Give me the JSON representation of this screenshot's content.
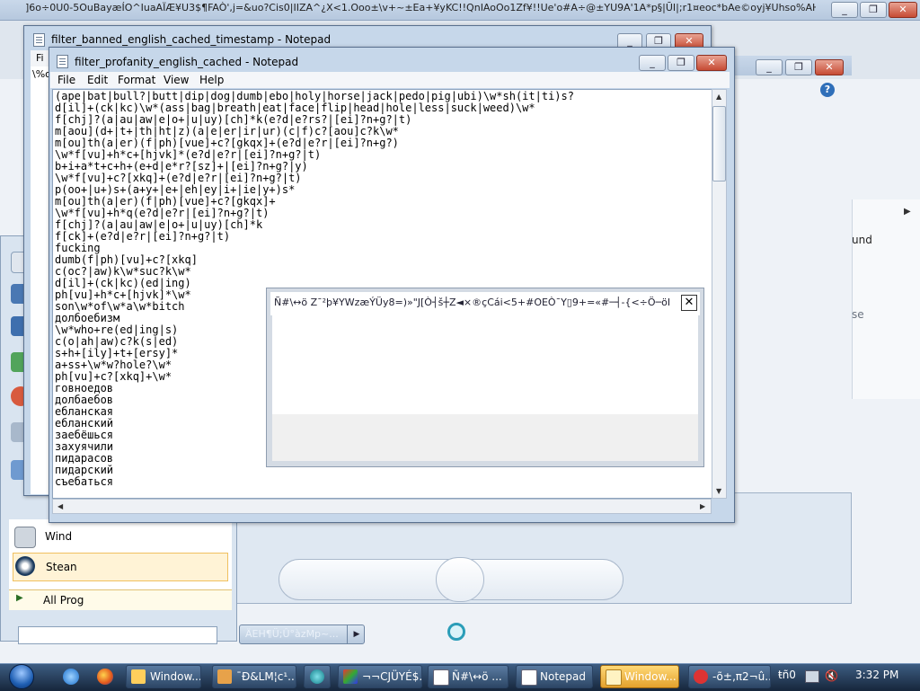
{
  "background_window": {
    "title": "]6o÷0U0-5OuBayæÍO^IuaAÏÆ¥U3$¶FAÒ',j=&uo?Cis0|IIZA^¿X<1.Ooo±\\v+~±Ea+¥yKC!!QnIAoOo1Zf¥!!Ue'o#A÷@±YU9A'1A*p§|ŪI|;r1¤eoc*bAe©oyj¥Uhso%AH..."
  },
  "right_panel": {
    "und_text": "und",
    "se_text": "se"
  },
  "start_menu": {
    "items": [
      {
        "label": "Wind"
      },
      {
        "label": "Stean"
      }
    ],
    "all_programs": "All Prog",
    "shutdown_label": "ÄEH¶Ü;Û°àzMp~..."
  },
  "notepad_back": {
    "title": "filter_banned_english_cached_timestamp - Notepad",
    "menu_first": "Fi",
    "corner_text": "\\%ol"
  },
  "notepad_front": {
    "title": "filter_profanity_english_cached - Notepad",
    "menu": {
      "file": "File",
      "edit": "Edit",
      "format": "Format",
      "view": "View",
      "help": "Help"
    },
    "lines": [
      "(ape|bat|bull?|butt|dip|dog|dumb|ebo|holy|horse|jack|pedo|pig|ubi)\\w*sh(it|ti)s?",
      "d[il]+(ck|kc)\\w*(ass|bag|breath|eat|face|flip|head|hole|less|suck|weed)\\w*",
      "f[chj]?(a|au|aw|e|o+|u|uy)[ch]*k(e?d|e?rs?|[ei]?n+g?|t)",
      "m[aou](d+|t+|th|ht|z)(a|e|er|ir|ur)(c|f)c?[aou]c?k\\w*",
      "m[ou]th(a|er)(f|ph)[vue]+c?[gkqx]+(e?d|e?r|[ei]?n+g?)",
      "\\w*f[vu]+h*c+[hjvk]*(e?d|e?r|[ei]?n+g?|t)",
      "b+i+a*t+c+h+(e+d|e*r?[sz]+|[ei]?n+g?|y)",
      "\\w*f[vu]+c?[xkq]+(e?d|e?r|[ei]?n+g?|t)",
      "p(oo+|u+)s+(a+y+|e+|eh|ey|i+|ie|y+)s*",
      "m[ou]th(a|er)(f|ph)[vue]+c?[gkqx]+",
      "\\w*f[vu]+h*q(e?d|e?r|[ei]?n+g?|t)",
      "f[chj]?(a|au|aw|e|o+|u|uy)[ch]*k",
      "f[ck]+(e?d|e?r|[ei]?n+g?|t)",
      "fucking",
      "dumb(f|ph)[vu]+c?[xkq]",
      "c(oc?|aw)k\\w*suc?k\\w*",
      "d[il]+(ck|kc)(ed|ing)",
      "ph[vu]+h*c+[hjvk]*\\w*",
      "son\\w*of\\w*a\\w*bitch",
      "долбоебизм",
      "\\w*who+re(ed|ing|s)",
      "c(o|ah|aw)c?k(s|ed)",
      "s+h+[ily]+t+[ersy]*",
      "a+ss+\\w*w?hole?\\w*",
      "ph[vu]+c?[xkq]+\\w*",
      "говноедов",
      "долбаебов",
      "ебланская",
      "ебланский",
      "заебёшься",
      "захуячили",
      "пидарасов",
      "пидарский",
      "съебаться"
    ]
  },
  "popup": {
    "title": "Ñ#\\↔ö    Z¯²þ¥YWzæÝÜy8=)»\"J[Ò┤š┼Z◄×®çCái<5+#OEÒ¯Y▯9+=«#─┤-{<÷Ö─öFT...",
    "close_label": "✕"
  },
  "taskbar": {
    "buttons": [
      {
        "label": "Window...",
        "active": false
      },
      {
        "label": "¯Ð&LM¦c¹...",
        "active": false
      },
      {
        "label": "",
        "active": false
      },
      {
        "label": "¬¬CJÜYÉ$...",
        "active": false
      },
      {
        "label": "Ñ#\\↔ö ...",
        "active": false
      },
      {
        "label": "Notepad",
        "active": false
      },
      {
        "label": "Window...",
        "active": true
      },
      {
        "label": "-õ±‚π2¬û...",
        "active": false
      }
    ],
    "tray_text": "ŧñ0",
    "clock": "3:32 PM"
  },
  "colors": {
    "taskbar": "#1f3450",
    "active_task": "#f0b845",
    "notepad_frame": "#c6d7ea"
  }
}
